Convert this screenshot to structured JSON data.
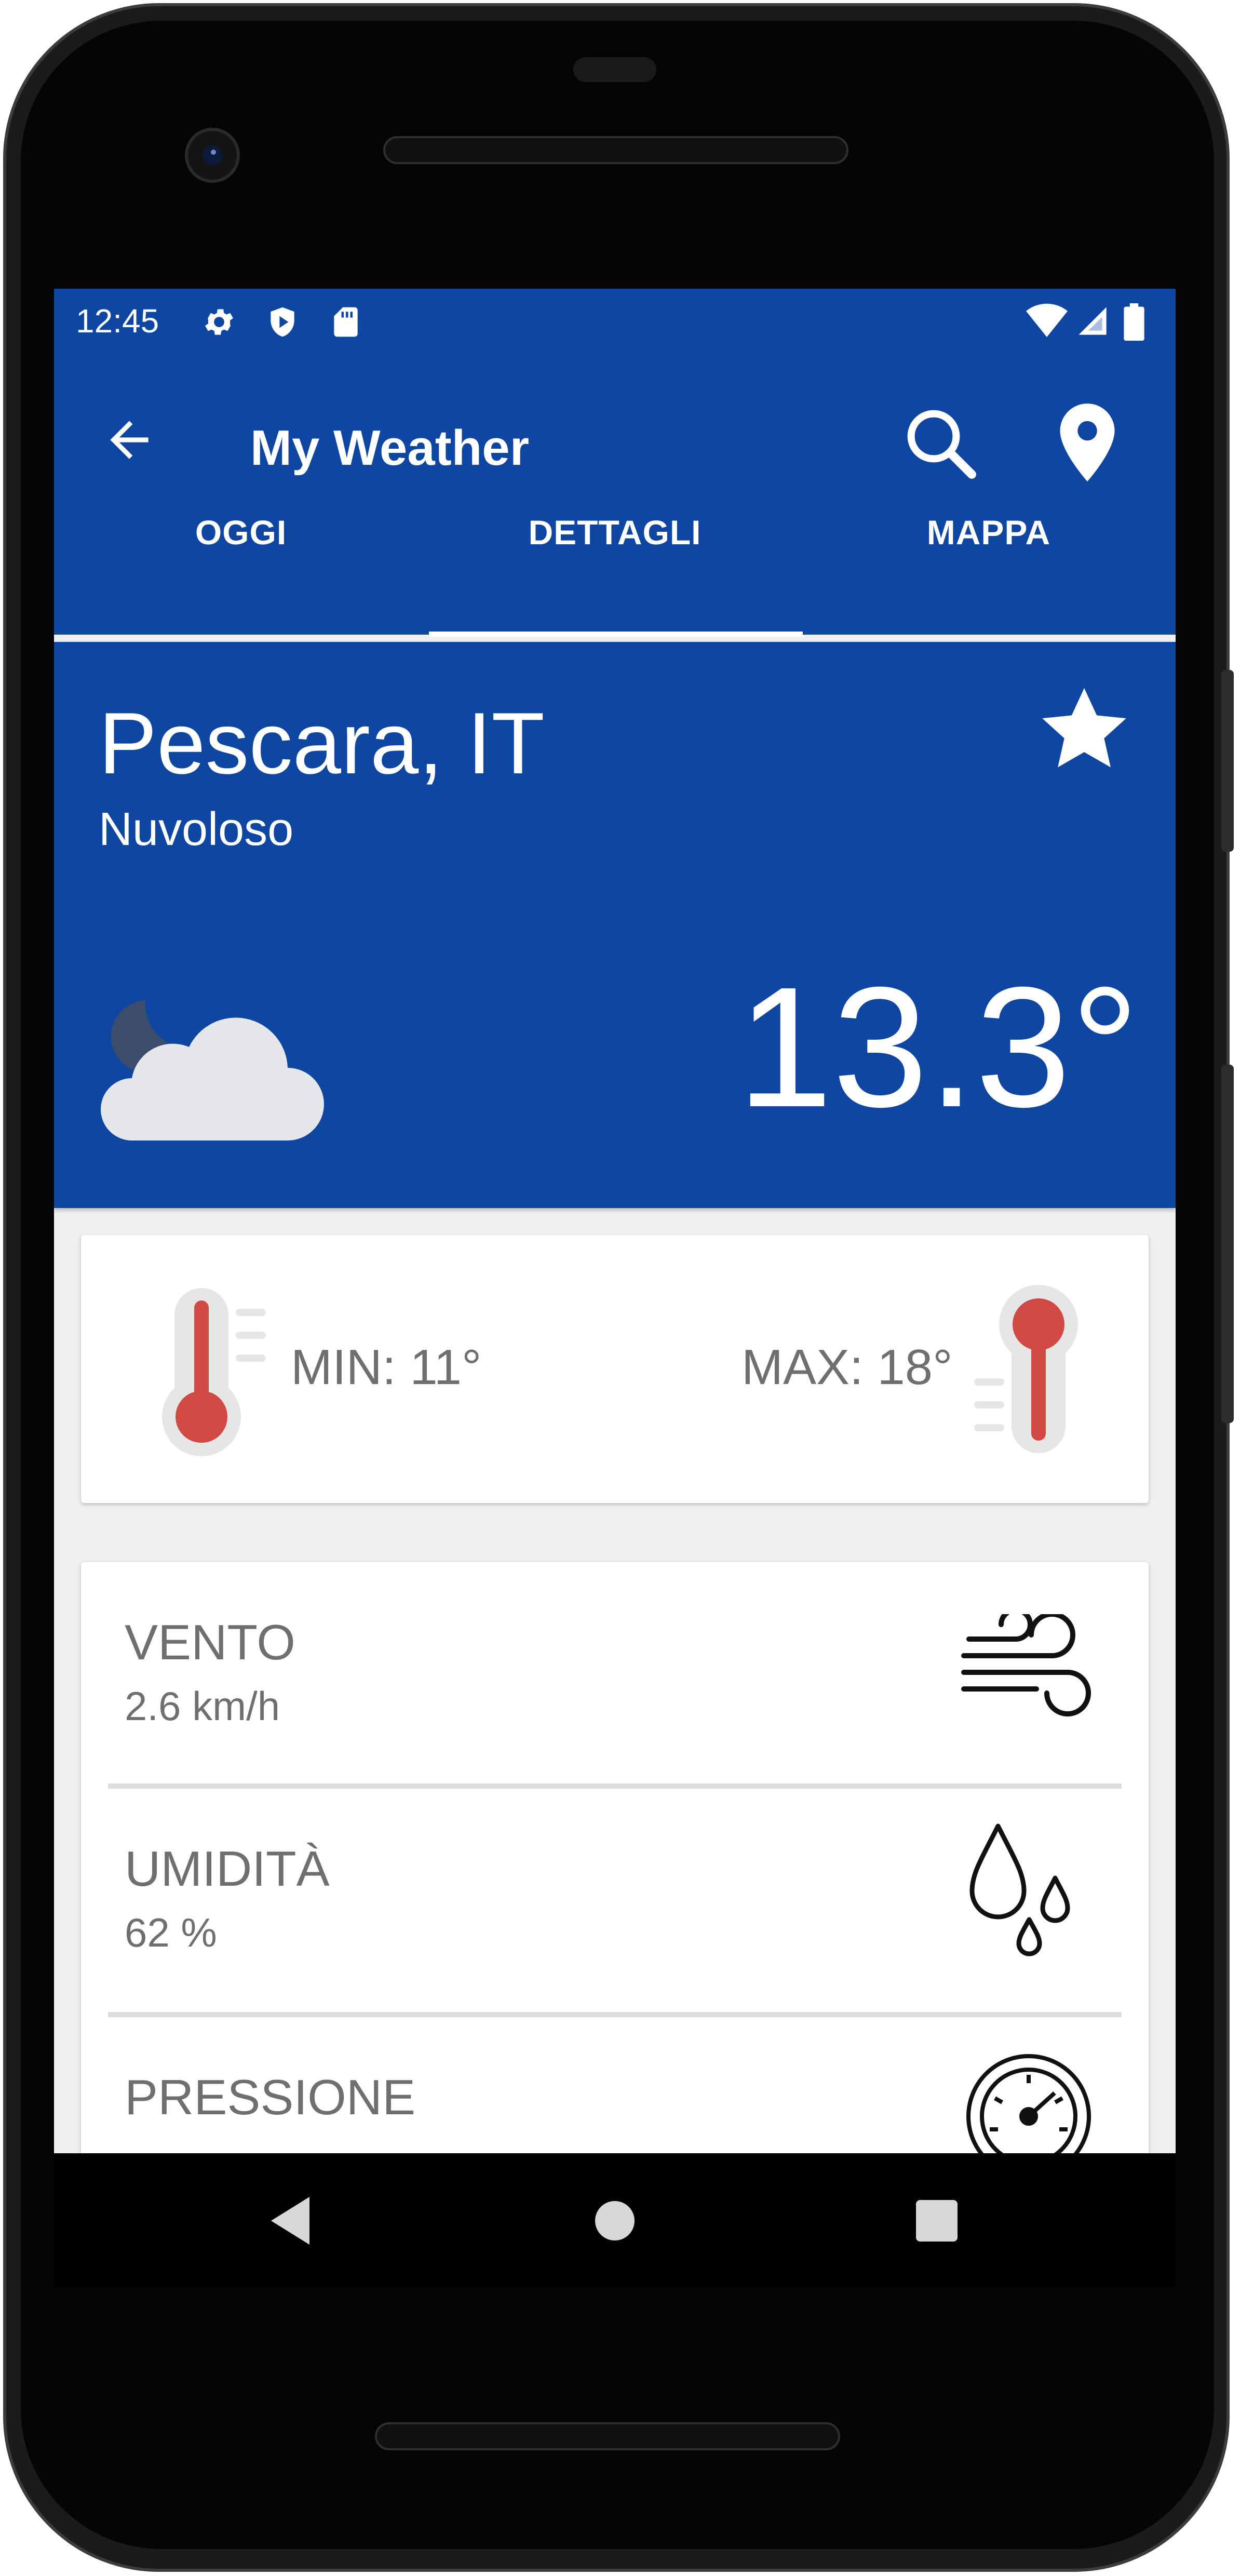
{
  "status_bar": {
    "time": "12:45"
  },
  "app_bar": {
    "title": "My Weather"
  },
  "tabs": [
    {
      "label": "OGGI"
    },
    {
      "label": "DETTAGLI"
    },
    {
      "label": "MAPPA"
    }
  ],
  "location": {
    "city": "Pescara, IT",
    "condition": "Nuvoloso",
    "temperature": "13.3°"
  },
  "min_max": {
    "min_label": "MIN:  11°",
    "max_label": "MAX: 18°"
  },
  "details": [
    {
      "label": "VENTO",
      "value": "2.6 km/h",
      "icon": "wind-icon"
    },
    {
      "label": "UMIDITÀ",
      "value": "62 %",
      "icon": "humidity-icon"
    },
    {
      "label": "PRESSIONE",
      "value": "",
      "icon": "gauge-icon"
    }
  ],
  "colors": {
    "primary": "#0e46a2",
    "thermometer_red": "#d04a43",
    "text_gray": "#6f6f6f"
  }
}
